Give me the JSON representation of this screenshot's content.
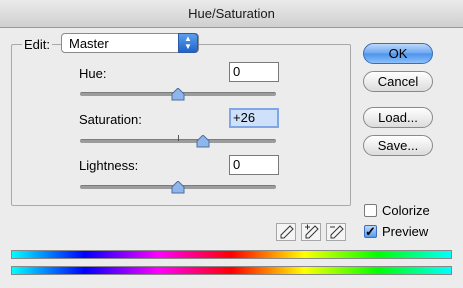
{
  "window": {
    "title": "Hue/Saturation"
  },
  "edit": {
    "label": "Edit:",
    "value": "Master"
  },
  "hue": {
    "label": "Hue:",
    "value": "0",
    "slider_level": 0.5
  },
  "saturation": {
    "label": "Saturation:",
    "value": "+26",
    "slider_level": 0.63
  },
  "lightness": {
    "label": "Lightness:",
    "value": "0",
    "slider_level": 0.5
  },
  "buttons": {
    "ok": "OK",
    "cancel": "Cancel",
    "load": "Load...",
    "save": "Save..."
  },
  "options": {
    "colorize": {
      "label": "Colorize",
      "checked": false
    },
    "preview": {
      "label": "Preview",
      "checked": true
    }
  },
  "icons": [
    "eyedropper-icon",
    "eyedropper-plus-icon",
    "eyedropper-minus-icon"
  ]
}
